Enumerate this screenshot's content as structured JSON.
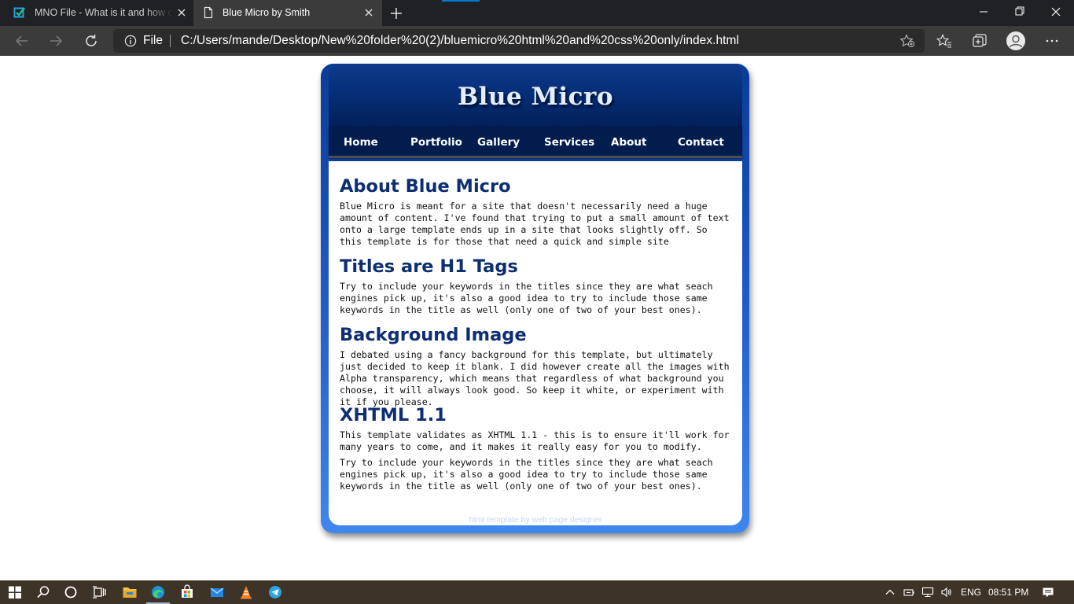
{
  "browser": {
    "tabs": [
      {
        "title": "MNO File - What is it and how do I open it?"
      },
      {
        "title": "Blue Micro by Smith"
      }
    ],
    "address": {
      "scheme_label": "File",
      "url": "C:/Users/mande/Desktop/New%20folder%20(2)/bluemicro%20html%20and%20css%20only/index.html"
    }
  },
  "page": {
    "site_title": "Blue Micro",
    "nav": [
      "Home",
      "Portfolio",
      "Gallery",
      "Services",
      "About",
      "Contact"
    ],
    "sections": [
      {
        "title": "About Blue Micro",
        "paragraphs": [
          "Blue Micro is meant for a site that doesn't necessarily need a huge amount of content. I've found that trying to put a small amount of text onto a large template ends up in a site that looks slightly off. So this template is for those that need a quick and simple site"
        ]
      },
      {
        "title": "Titles are H1 Tags",
        "paragraphs": [
          "Try to include your keywords in the titles since they are what seach engines pick up, it's also a good idea to try to include those same keywords in the title as well (only one of two of your best ones)."
        ]
      },
      {
        "title": "Background Image",
        "paragraphs": [
          "I debated using a fancy background for this template, but ultimately just decided to keep it blank. I did however create all the images with Alpha transparency, which means that regardless of what background you choose, it will always look good. So keep it white, or experiment with it if you please."
        ]
      },
      {
        "title": "XHTML 1.1",
        "paragraphs": [
          "This template validates as XHTML 1.1 - this is to ensure it'll work for many years to come, and it makes it really easy for you to modify.",
          "Try to include your keywords in the titles since they are what seach engines pick up, it's also a good idea to try to include those same keywords in the title as well (only one of two of your best ones)."
        ]
      }
    ],
    "footer": "html template by web page designer"
  },
  "taskbar": {
    "language": "ENG",
    "time": "08:51 PM"
  },
  "colors": {
    "heading": "#0e2e72",
    "header_dark": "#022059",
    "frame_light": "#3f86ee",
    "footer_text": "#c7d8ef",
    "taskbar": "#3d3427"
  }
}
